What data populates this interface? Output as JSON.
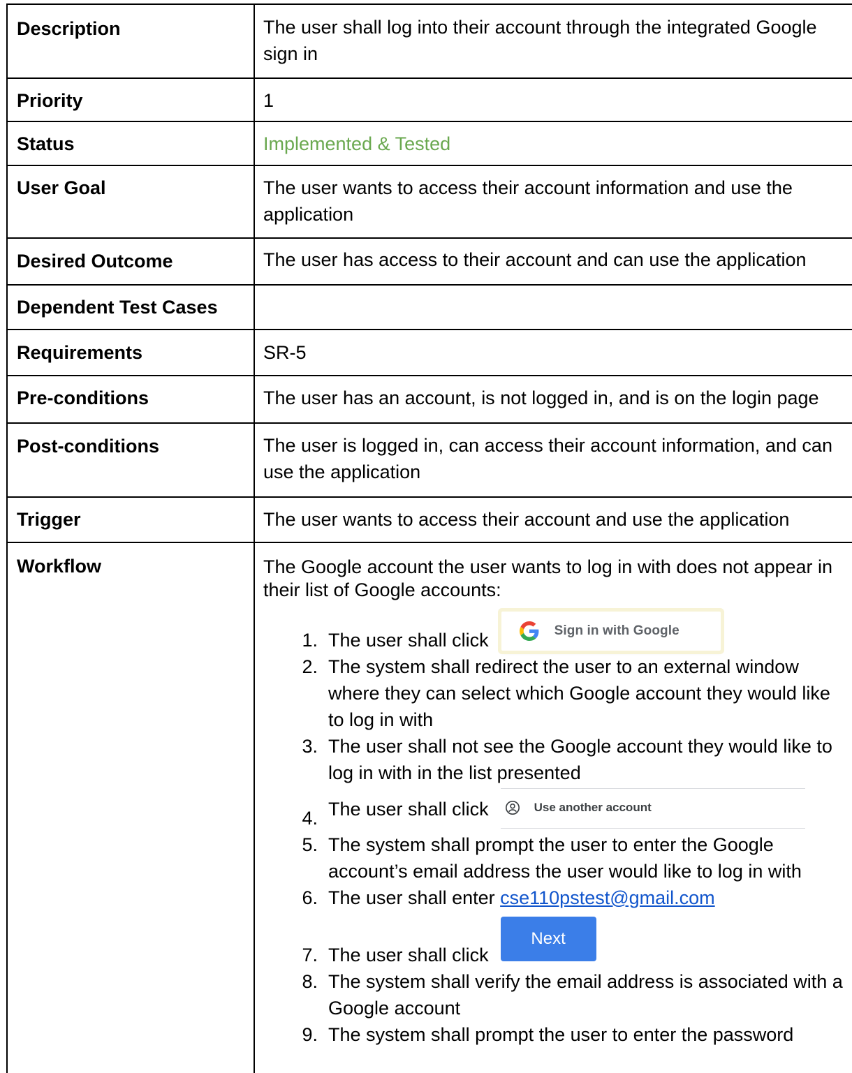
{
  "rows": [
    {
      "label": "Description",
      "value": "The user shall log into their account through the integrated Google sign in"
    },
    {
      "label": "Priority",
      "value": "1"
    },
    {
      "label": "Status",
      "value": "Implemented & Tested"
    },
    {
      "label": "User Goal",
      "value": "The user wants to access their account information and use the application"
    },
    {
      "label": "Desired Outcome",
      "value": "The user has access to their account and can use the application"
    },
    {
      "label": "Dependent Test Cases",
      "value": ""
    },
    {
      "label": "Requirements",
      "value": "SR-5"
    },
    {
      "label": "Pre-conditions",
      "value": "The user has an account, is not logged in, and is on the login page"
    },
    {
      "label": "Post-conditions",
      "value": "The user is logged in, can access their account information, and can use the application"
    },
    {
      "label": "Trigger",
      "value": "The user wants to access their account and use the application"
    },
    {
      "label": "Workflow"
    }
  ],
  "colors": {
    "status": "#6aa84f",
    "link": "#1155cc",
    "next_button": "#3b7ee8"
  },
  "workflow": {
    "intro": "The Google account the user wants to log in with does not appear in their list of Google accounts:",
    "steps": [
      {
        "num": "1.",
        "text": "The user shall click"
      },
      {
        "num": "2.",
        "text": "The system shall redirect the user to an external window where they can select which Google account they would like to log in with"
      },
      {
        "num": "3.",
        "text": "The user shall not see the Google account they would like to log in with in the list presented"
      },
      {
        "num": "4.",
        "text": "The user shall click"
      },
      {
        "num": "5.",
        "text": "The system shall prompt the user to enter the Google account’s email address the user would like to log in with"
      },
      {
        "num": "6.",
        "text": "The user shall enter "
      },
      {
        "num": "7.",
        "text": "The user shall click"
      },
      {
        "num": "8.",
        "text": "The system shall verify the email address is associated with a Google account"
      },
      {
        "num": "9.",
        "text": "The system shall prompt the user to enter the password"
      }
    ],
    "google_button": {
      "label": "Sign in with Google",
      "icon": "google-g-icon"
    },
    "another_account": {
      "label": "Use another account",
      "icon": "account-circle-icon"
    },
    "email": "cse110pstest@gmail.com",
    "next_button": {
      "label": "Next"
    }
  }
}
